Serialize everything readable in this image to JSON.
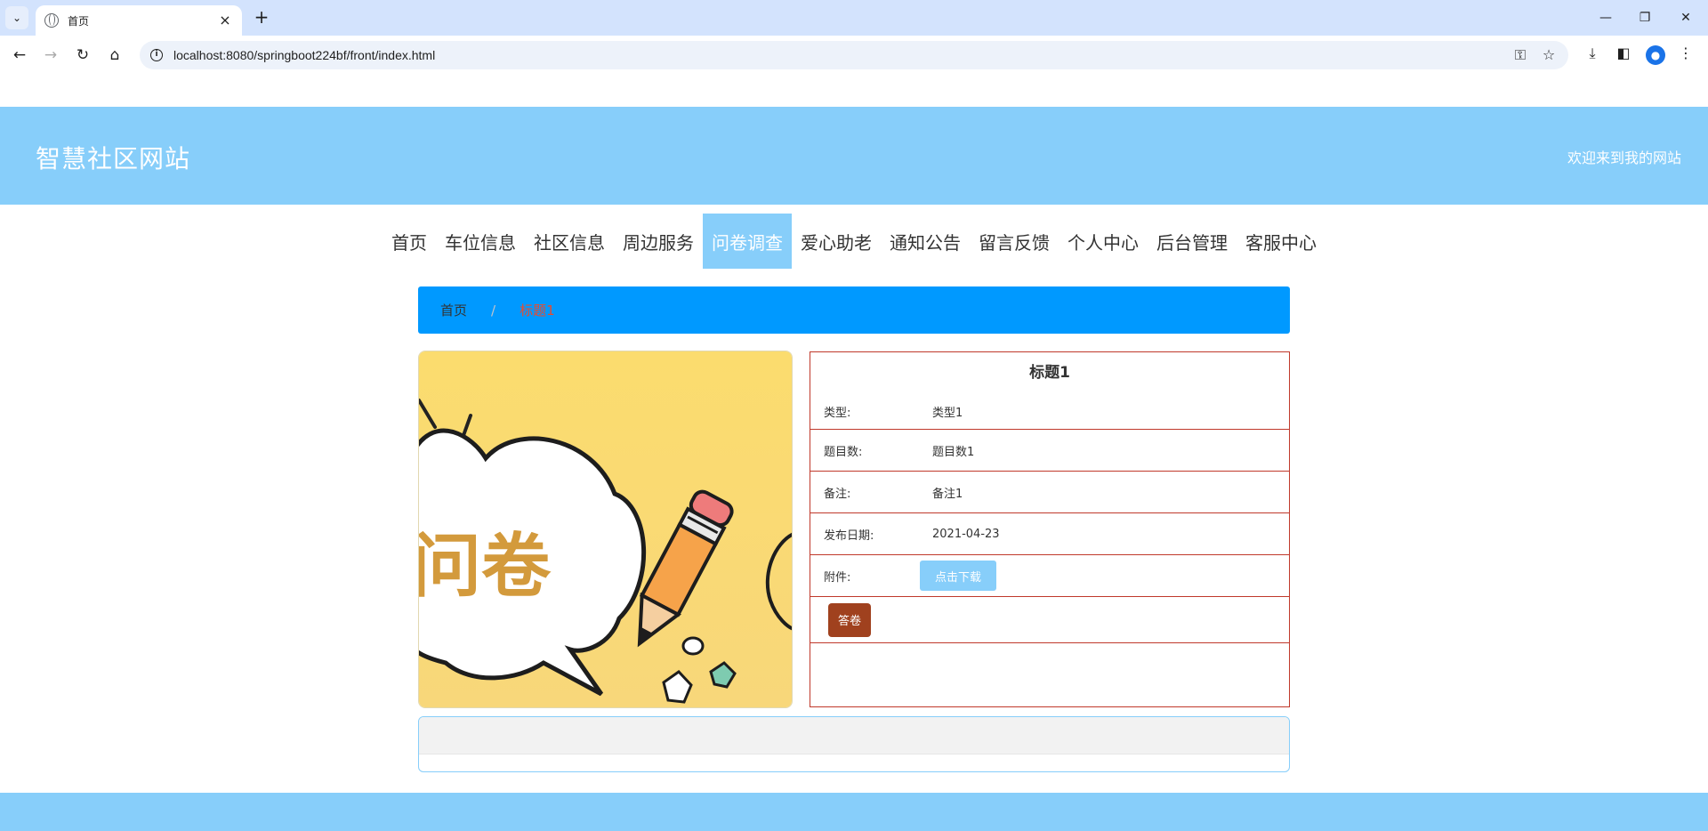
{
  "browser": {
    "tab_title": "首页",
    "url": "localhost:8080/springboot224bf/front/index.html"
  },
  "header": {
    "site_title": "智慧社区网站",
    "welcome": "欢迎来到我的网站"
  },
  "nav": {
    "items": [
      {
        "label": "首页",
        "active": false
      },
      {
        "label": "车位信息",
        "active": false
      },
      {
        "label": "社区信息",
        "active": false
      },
      {
        "label": "周边服务",
        "active": false
      },
      {
        "label": "问卷调查",
        "active": true
      },
      {
        "label": "爱心助老",
        "active": false
      },
      {
        "label": "通知公告",
        "active": false
      },
      {
        "label": "留言反馈",
        "active": false
      },
      {
        "label": "个人中心",
        "active": false
      },
      {
        "label": "后台管理",
        "active": false
      },
      {
        "label": "客服中心",
        "active": false
      }
    ]
  },
  "breadcrumb": {
    "home": "首页",
    "separator": "/",
    "current": "标题1"
  },
  "cover": {
    "text": "问卷"
  },
  "detail": {
    "title": "标题1",
    "type_label": "类型:",
    "type_value": "类型1",
    "count_label": "题目数:",
    "count_value": "题目数1",
    "note_label": "备注:",
    "note_value": "备注1",
    "date_label": "发布日期:",
    "date_value": "2021-04-23",
    "attachment_label": "附件:",
    "download_label": "点击下载",
    "answer_label": "答卷"
  },
  "colors": {
    "header_bg": "#87cefa",
    "breadcrumb_bg": "#0099ff",
    "detail_border": "#c0392b",
    "answer_btn": "#a0411e"
  }
}
